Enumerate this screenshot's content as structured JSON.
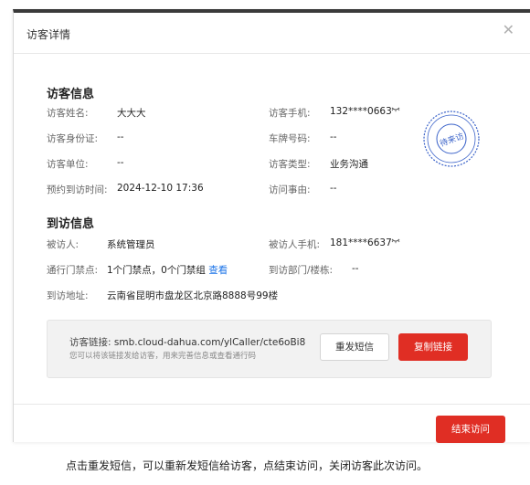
{
  "dialog": {
    "title": "访客详情",
    "close_icon": "close-icon",
    "visitor_section": {
      "title": "访客信息",
      "name_label": "访客姓名:",
      "name_value": "大大大",
      "phone_label": "访客手机:",
      "phone_value": "132****0663",
      "id_label": "访客身份证:",
      "id_value": "--",
      "plate_label": "车牌号码:",
      "plate_value": "--",
      "company_label": "访客单位:",
      "company_value": "--",
      "type_label": "访客类型:",
      "type_value": "业务沟通",
      "time_label": "预约到访时间:",
      "time_value": "2024-12-10 17:36",
      "reason_label": "访问事由:",
      "reason_value": "--",
      "stamp_text": "待来访",
      "stamp_color": "#3b63c9"
    },
    "visit_section": {
      "title": "到访信息",
      "host_label": "被访人:",
      "host_value": "系统管理员",
      "host_phone_label": "被访人手机:",
      "host_phone_value": "181****6637",
      "gate_label": "通行门禁点:",
      "gate_value": "1个门禁点，0个门禁组",
      "gate_link": "查看",
      "dept_label": "到访部门/楼栋:",
      "dept_value": "--",
      "address_label": "到访地址:",
      "address_value": "云南省昆明市盘龙区北京路8888号99楼"
    },
    "share": {
      "link_label": "访客链接:",
      "link_value": "smb.cloud-dahua.com/ylCaller/cte6oBi8",
      "hint": "您可以将该链接发给访客，用来完善信息或查看通行码",
      "resend_label": "重发短信",
      "copy_label": "复制链接"
    },
    "end_label": "结束访问"
  },
  "caption": "点击重发短信，可以重新发短信给访客，点结束访问，关闭访客此次访问。",
  "colors": {
    "primary": "#e02e24",
    "link": "#1a73e8"
  }
}
